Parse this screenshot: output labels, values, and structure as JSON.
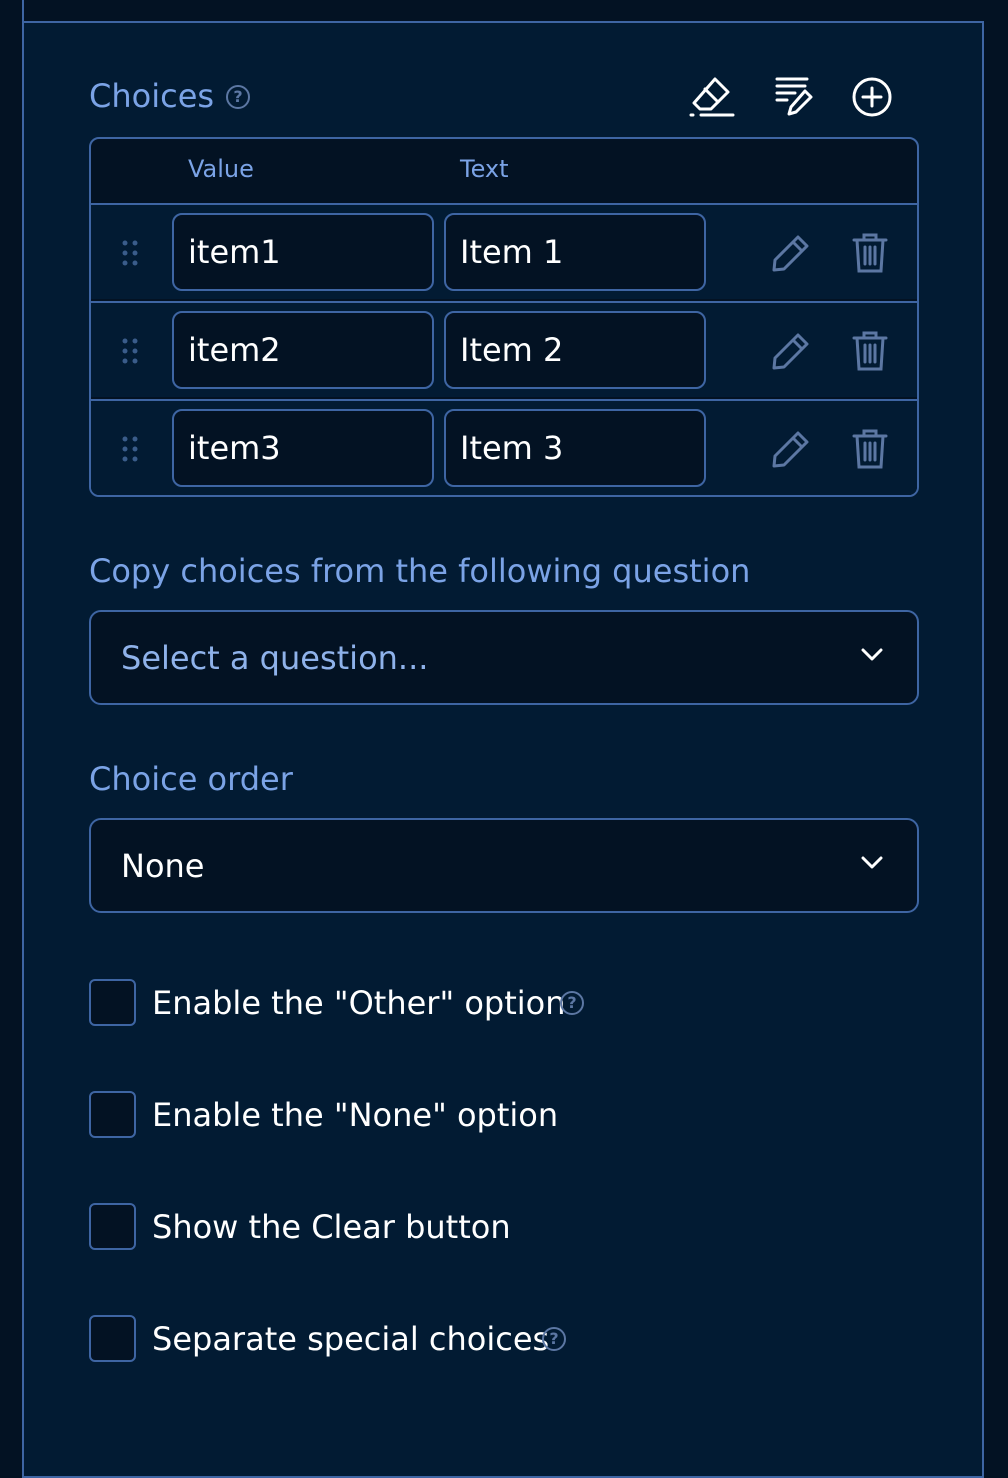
{
  "choices": {
    "title": "Choices",
    "help_icon": "question-circle-icon",
    "toolbar_icons": [
      "eraser-icon",
      "bulk-edit-icon",
      "add-circle-icon"
    ],
    "columns": {
      "value": "Value",
      "text": "Text"
    },
    "rows": [
      {
        "value": "item1",
        "text": "Item 1"
      },
      {
        "value": "item2",
        "text": "Item 2"
      },
      {
        "value": "item3",
        "text": "Item 3"
      }
    ]
  },
  "copy_choices": {
    "label": "Copy choices from the following question",
    "placeholder": "Select a question..."
  },
  "choice_order": {
    "label": "Choice order",
    "value": "None"
  },
  "options": [
    {
      "label": "Enable the \"Other\" option",
      "checked": false,
      "has_help": true
    },
    {
      "label": "Enable the \"None\" option",
      "checked": false,
      "has_help": false
    },
    {
      "label": "Show the Clear button",
      "checked": false,
      "has_help": false
    },
    {
      "label": "Separate special choices",
      "checked": false,
      "has_help": true
    }
  ],
  "colors": {
    "page_background": "#031223",
    "panel_background": "#021b33",
    "border": "#3e65a3",
    "label": "#7ba3e6",
    "muted_icon": "#5c77a3",
    "text": "#ffffff"
  }
}
